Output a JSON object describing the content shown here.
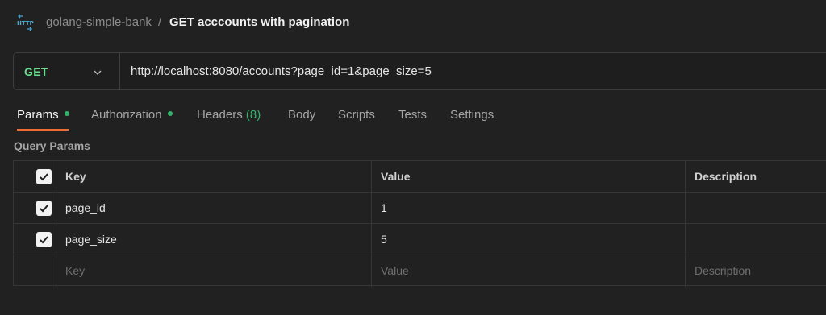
{
  "breadcrumb": {
    "icon": "http-icon",
    "parent": "golang-simple-bank",
    "separator": "/",
    "current": "GET acccounts with pagination"
  },
  "request": {
    "method": "GET",
    "url": "http://localhost:8080/accounts?page_id=1&page_size=5"
  },
  "tabs": [
    {
      "label": "Params",
      "active": true,
      "dot": true
    },
    {
      "label": "Authorization",
      "dot": true
    },
    {
      "label": "Headers",
      "count": "(8)"
    },
    {
      "label": "Body"
    },
    {
      "label": "Scripts"
    },
    {
      "label": "Tests"
    },
    {
      "label": "Settings"
    }
  ],
  "query_params": {
    "title": "Query Params",
    "columns": [
      "Key",
      "Value",
      "Description"
    ],
    "rows": [
      {
        "checked": true,
        "key": "page_id",
        "value": "1",
        "description": ""
      },
      {
        "checked": true,
        "key": "page_size",
        "value": "5",
        "description": ""
      }
    ],
    "placeholder": {
      "key": "Key",
      "value": "Value",
      "description": "Description"
    }
  },
  "colors": {
    "background": "#212121",
    "method_get": "#6bdd8f",
    "active_underline": "#f06c35",
    "status_dot": "#35b56b"
  }
}
